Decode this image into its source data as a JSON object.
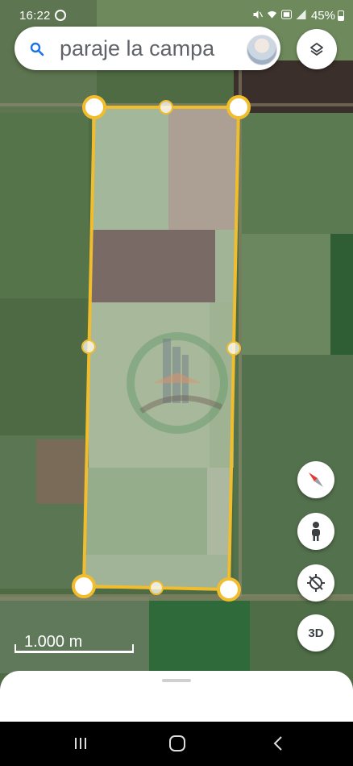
{
  "status_bar": {
    "time": "16:22",
    "battery": "45%",
    "icons": [
      "whatsapp-icon",
      "mute-icon",
      "wifi-icon",
      "volte-icon",
      "signal-icon",
      "battery-icon"
    ]
  },
  "search": {
    "value": "paraje la campa"
  },
  "map_controls": {
    "view_3d_label": "3D"
  },
  "scale": {
    "label": "1.000 m"
  },
  "colors": {
    "polygon_stroke": "#f2bd2c",
    "polygon_fill": "rgba(255,255,255,0.18)",
    "compass_red": "#e53935",
    "search_icon": "#1a73e8"
  }
}
